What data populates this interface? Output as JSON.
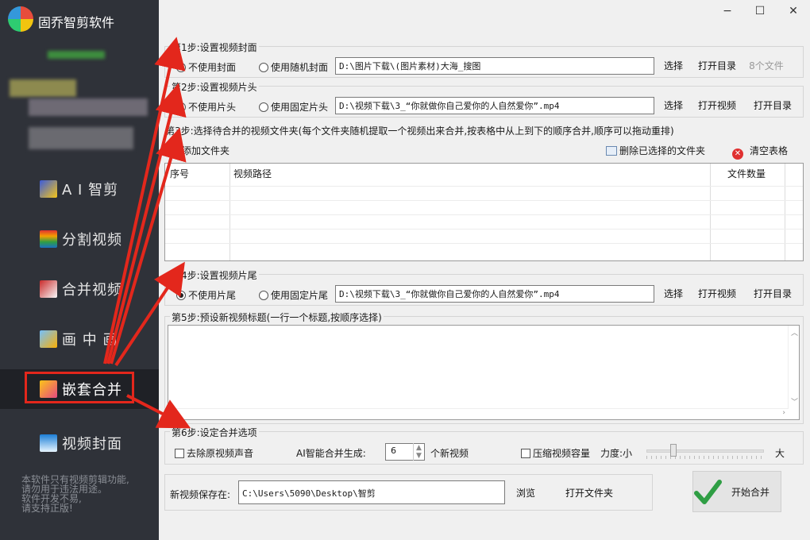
{
  "app": {
    "title": "固乔智剪软件"
  },
  "sidebar": {
    "items": [
      {
        "label": "A I 智剪",
        "icon": "ai-magic-icon"
      },
      {
        "label": "分割视频",
        "icon": "split-video-icon"
      },
      {
        "label": "合并视频",
        "icon": "merge-video-icon"
      },
      {
        "label": "画 中 画",
        "icon": "picture-in-picture-icon"
      },
      {
        "label": "嵌套合并",
        "icon": "nested-merge-icon",
        "active": true
      },
      {
        "label": "视频封面",
        "icon": "video-cover-icon"
      }
    ],
    "footer_lines": [
      "本软件只有视频剪辑功能,",
      "请勿用于违法用途。",
      "软件开发不易,",
      "请支持正版!"
    ]
  },
  "window": {
    "minimize": "−",
    "maximize": "☐",
    "close": "✕"
  },
  "step1": {
    "label": "第1步:设置视频封面",
    "radio_none": "不使用封面",
    "radio_random": "使用随机封面",
    "path": "D:\\图片下载\\(图片素材)大海_搜图",
    "select": "选择",
    "open_dir": "打开目录",
    "file_count": "8个文件"
  },
  "step2": {
    "label": "第2步:设置视频片头",
    "radio_none": "不使用片头",
    "radio_fixed": "使用固定片头",
    "path": "D:\\视频下载\\3_“你就做你自己爱你的人自然爱你”.mp4",
    "select": "选择",
    "open_video": "打开视频",
    "open_dir": "打开目录"
  },
  "step3": {
    "label": "第3步:选择待合并的视频文件夹(每个文件夹随机提取一个视频出来合并,按表格中从上到下的顺序合并,顺序可以拖动重排)",
    "add_folder": "添加文件夹",
    "delete_selected": "删除已选择的文件夹",
    "clear_table": "清空表格",
    "columns": [
      "序号",
      "视频路径",
      "文件数量"
    ]
  },
  "step4": {
    "label": "第4步:设置视频片尾",
    "radio_none": "不使用片尾",
    "radio_fixed": "使用固定片尾",
    "path": "D:\\视频下载\\3_“你就做你自己爱你的人自然爱你”.mp4",
    "select": "选择",
    "open_video": "打开视频",
    "open_dir": "打开目录"
  },
  "step5": {
    "label": "第5步:预设新视频标题(一行一个标题,按顺序选择)"
  },
  "step6": {
    "label": "第6步:设定合并选项",
    "remove_audio": "去除原视频声音",
    "ai_generate": "AI智能合并生成:",
    "count": "6",
    "count_suffix": "个新视频",
    "compress": "压缩视频容量",
    "strength": "力度:小",
    "strength_max": "大",
    "strength_value": 0.2
  },
  "save": {
    "label": "新视频保存在:",
    "path": "C:\\Users\\5090\\Desktop\\智剪",
    "browse": "浏览",
    "open_folder": "打开文件夹"
  },
  "start": {
    "label": "开始合并"
  }
}
